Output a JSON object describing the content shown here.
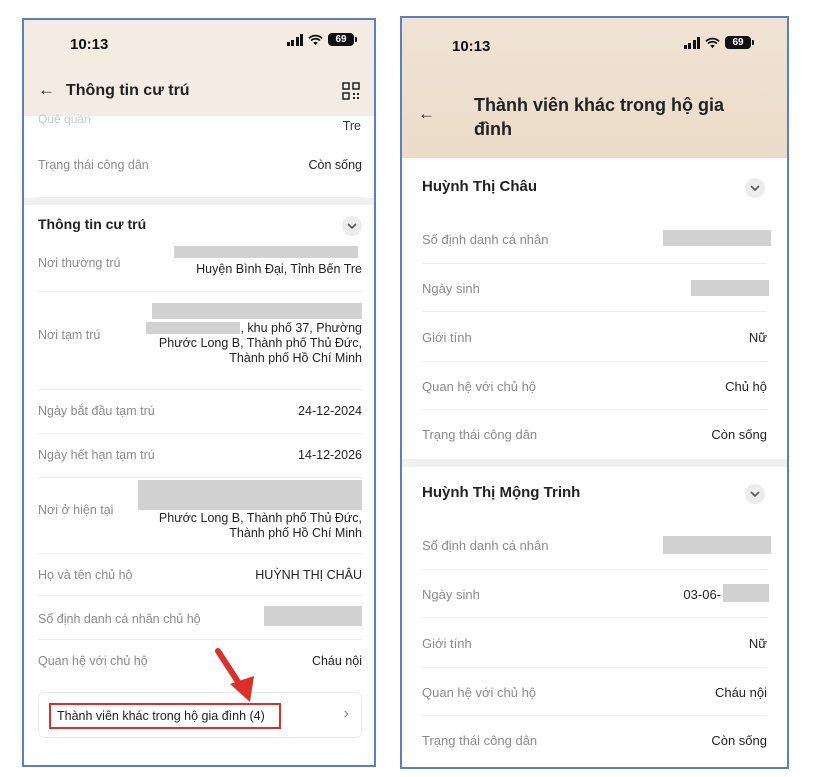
{
  "left": {
    "status": {
      "time": "10:13",
      "battery": "69"
    },
    "header": {
      "back_icon": "←",
      "title": "Thông tin cư trú",
      "qr_icon": "qr-code-icon"
    },
    "cut_row": {
      "value": "Tre"
    },
    "citizen_status": {
      "label": "Trạng thái công dân",
      "value": "Còn sống"
    },
    "section": {
      "title": "Thông tin cư trú"
    },
    "permanent": {
      "label": "Nơi thường trú",
      "value_line2": "Huyện Bình Đại, Tỉnh Bến Tre"
    },
    "temporary": {
      "label": "Nơi tạm trú",
      "line1": ", khu phố 37, Phường",
      "line2": "Phước Long B, Thành phố Thủ Đức,",
      "line3": "Thành phố Hồ Chí Minh"
    },
    "temp_start": {
      "label": "Ngày bắt đầu tạm trú",
      "value": "24-12-2024"
    },
    "temp_end": {
      "label": "Ngày hết hạn tạm trú",
      "value": "14-12-2026"
    },
    "current": {
      "label": "Nơi ở hiện tại",
      "line1": "Phước Long B, Thành phố Thủ Đức,",
      "line2": "Thành phố Hồ Chí Minh"
    },
    "head_name": {
      "label": "Họ và tên chủ hộ",
      "value": "HUỲNH THỊ CHÂU"
    },
    "head_id": {
      "label": "Số định danh cá nhân chủ hộ"
    },
    "relation": {
      "label": "Quan hệ với chủ hộ",
      "value": "Cháu nội"
    },
    "members_link": {
      "label": "Thành viên khác trong hộ gia đình (4)",
      "arrow": "›"
    },
    "annotation_color": "#d9302a"
  },
  "right": {
    "status": {
      "time": "10:13",
      "battery": "69"
    },
    "header": {
      "back_icon": "←",
      "title": "Thành viên khác trong hộ gia đình"
    },
    "members": [
      {
        "name": "Huỳnh Thị Châu",
        "id_label": "Số định danh cá nhân",
        "dob_label": "Ngày sinh",
        "gender_label": "Giới tính",
        "gender": "Nữ",
        "relation_label": "Quan hệ với chủ hộ",
        "relation": "Chủ hộ",
        "status_label": "Trạng thái công dân",
        "status": "Còn sống"
      },
      {
        "name": "Huỳnh Thị Mộng Trinh",
        "id_label": "Số định danh cá nhân",
        "dob_label": "Ngày sinh",
        "dob": "03-06-",
        "gender_label": "Giới tính",
        "gender": "Nữ",
        "relation_label": "Quan hệ với chủ hộ",
        "relation": "Cháu nội",
        "status_label": "Trạng thái công dân",
        "status": "Còn sống"
      }
    ]
  }
}
